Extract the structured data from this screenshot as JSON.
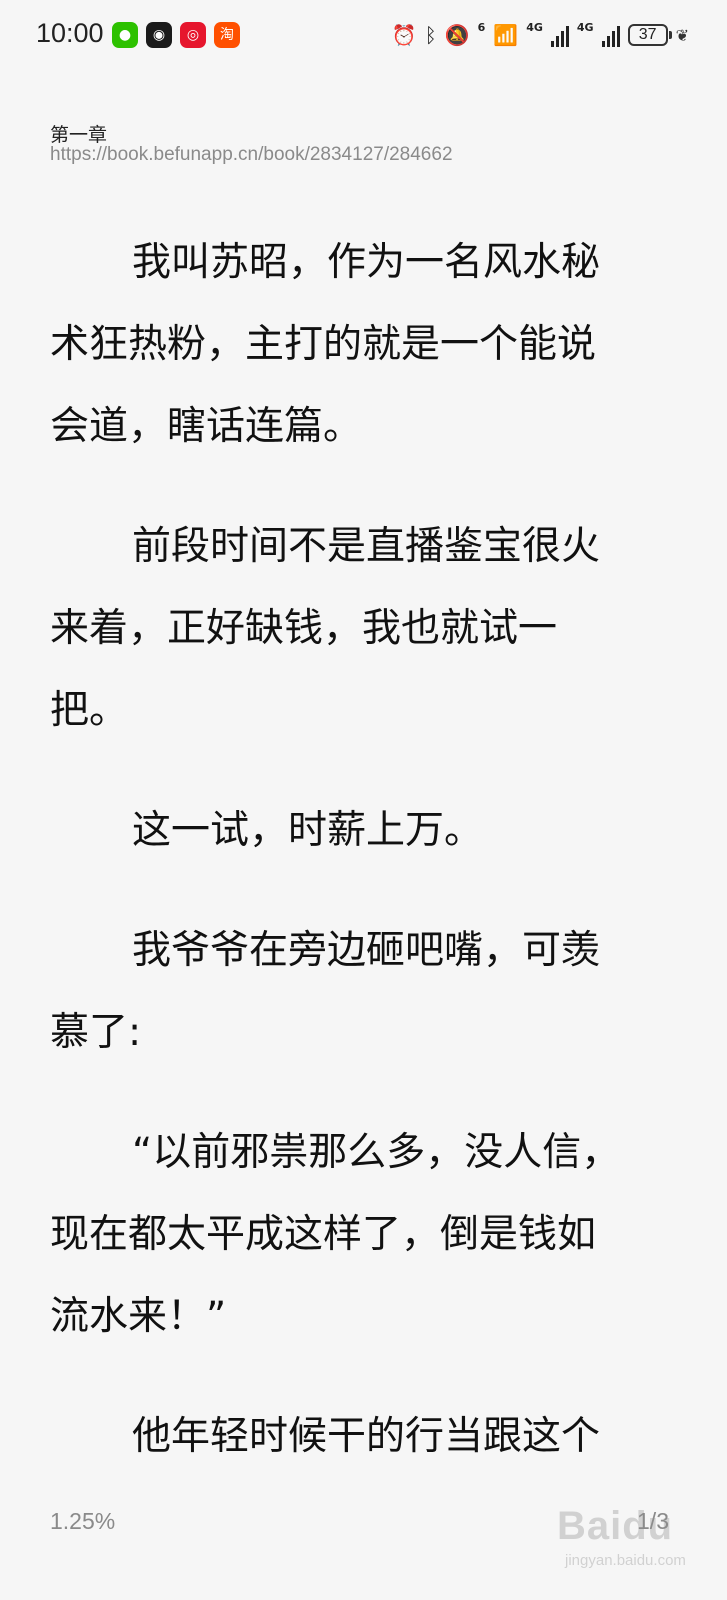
{
  "status_bar": {
    "time": "10:00",
    "battery": "37",
    "network_1": "4G",
    "network_2": "4G",
    "wifi_badge": "6",
    "apps": [
      {
        "name": "wechat-icon",
        "glyph": "●",
        "color": "#2dc100"
      },
      {
        "name": "qq-icon",
        "glyph": "◉",
        "color": "#1b1b1b"
      },
      {
        "name": "weibo-icon",
        "glyph": "◎",
        "color": "#e6162d"
      },
      {
        "name": "taobao-icon",
        "glyph": "淘",
        "color": "#ff5000"
      }
    ]
  },
  "chapter": {
    "title": "第一章",
    "url": "https://book.befunapp.cn/book/2834127/284662"
  },
  "paragraphs": [
    "我叫苏昭，作为一名风水秘术狂热粉，主打的就是一个能说会道，瞎话连篇。",
    "前段时间不是直播鉴宝很火来着，正好缺钱，我也就试一把。",
    "这一试，时薪上万。",
    "我爷爷在旁边砸吧嘴，可羡慕了:",
    "“以前邪祟那么多，没人信，现在都太平成这样了，倒是钱如流水来！”",
    "他年轻时候干的行当跟这个"
  ],
  "footer": {
    "progress": "1.25%",
    "page": "1/3"
  },
  "watermark": {
    "text": "Baidu",
    "sub": "jingyan.baidu.com"
  }
}
